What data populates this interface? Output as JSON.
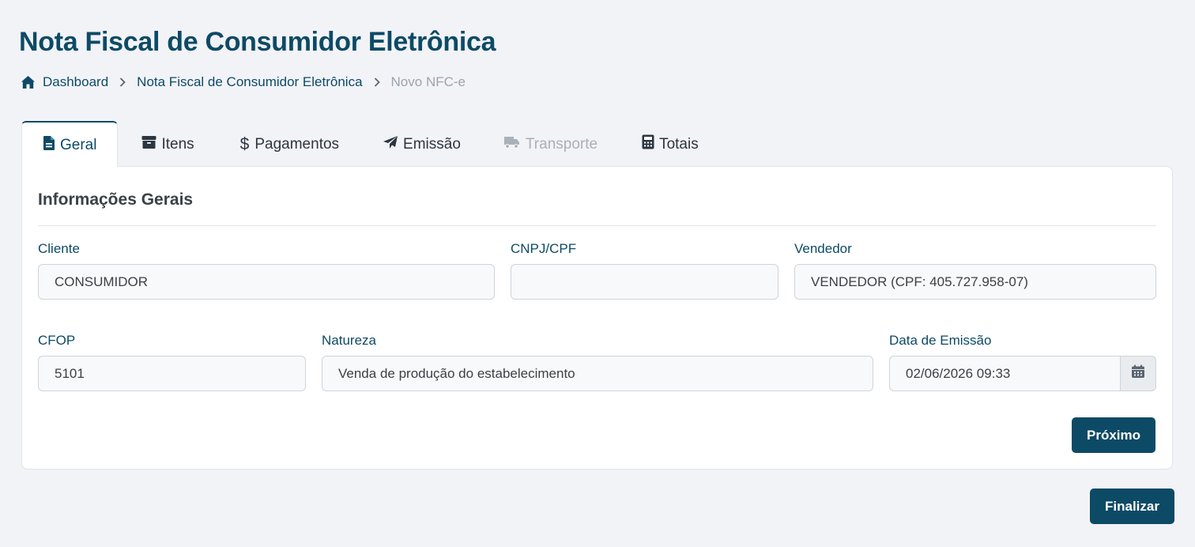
{
  "header": {
    "title": "Nota Fiscal de Consumidor Eletrônica"
  },
  "breadcrumb": {
    "items": [
      "Dashboard",
      "Nota Fiscal de Consumidor Eletrônica",
      "Novo NFC-e"
    ]
  },
  "tabs": [
    {
      "label": "Geral",
      "icon": "file-icon",
      "active": true
    },
    {
      "label": "Itens",
      "icon": "archive-icon"
    },
    {
      "label": "Pagamentos",
      "icon": "dollar-icon"
    },
    {
      "label": "Emissão",
      "icon": "paper-plane-icon"
    },
    {
      "label": "Transporte",
      "icon": "truck-icon",
      "disabled": true
    },
    {
      "label": "Totais",
      "icon": "calculator-icon"
    }
  ],
  "form": {
    "section_title": "Informações Gerais",
    "cliente": {
      "label": "Cliente",
      "value": "CONSUMIDOR"
    },
    "cnpj_cpf": {
      "label": "CNPJ/CPF",
      "value": ""
    },
    "vendedor": {
      "label": "Vendedor",
      "value": "VENDEDOR (CPF: 405.727.958-07)"
    },
    "cfop": {
      "label": "CFOP",
      "value": "5101"
    },
    "natureza": {
      "label": "Natureza",
      "value": "Venda de produção do estabelecimento"
    },
    "data_emissao": {
      "label": "Data de Emissão",
      "value": "02/06/2026 09:33",
      "icon": "calendar-icon"
    },
    "next_button": "Próximo"
  },
  "footer": {
    "finalize_button": "Finalizar"
  },
  "colors": {
    "primary": "#0d4a66",
    "background": "#f2f3f7",
    "disabled": "#a8b0b8"
  }
}
